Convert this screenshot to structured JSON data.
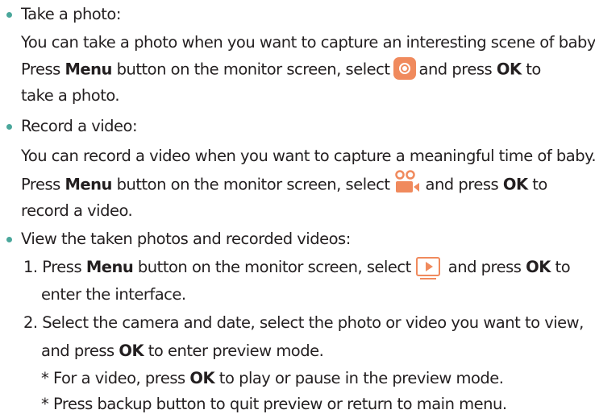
{
  "colors": {
    "bullet": "#4aa79b",
    "icon_accent": "#f08a5d",
    "text": "#231f20"
  },
  "icons": {
    "photo": "camera-photo-icon",
    "video": "video-record-icon",
    "playback": "playback-icon"
  },
  "sections": [
    {
      "heading": "Take a photo:",
      "line1": "You can take a photo when you want to capture an interesting scene of baby.",
      "line2_pre": "Press ",
      "line2_menu": "Menu",
      "line2_mid": " button on the monitor screen, select",
      "line2_and": "and press ",
      "line2_ok": "OK",
      "line2_post": " to",
      "line3": "take a photo."
    },
    {
      "heading": "Record a video:",
      "line1": "You can record a video when you want to capture a meaningful time of baby.",
      "line2_pre": "Press ",
      "line2_menu": "Menu",
      "line2_mid": " button on the monitor screen, select",
      "line2_and": "and press ",
      "line2_ok": "OK",
      "line2_post": " to",
      "line3": "record a video."
    },
    {
      "heading": "View the taken photos and recorded videos:",
      "step1_pre": "1. Press ",
      "step1_menu": "Menu",
      "step1_mid": " button on the monitor screen, select",
      "step1_and": "and press ",
      "step1_ok": "OK",
      "step1_post": " to",
      "step1_cont": "enter the interface.",
      "step2_line1": "2. Select the camera and date, select the photo or video you want to view,",
      "step2_pre": "and press ",
      "step2_ok": "OK",
      "step2_post": " to enter preview mode.",
      "note1_pre": "* For a video, press ",
      "note1_ok": "OK",
      "note1_post": " to play or pause in the preview mode.",
      "note2": "* Press backup button to quit preview or return to main menu."
    }
  ]
}
